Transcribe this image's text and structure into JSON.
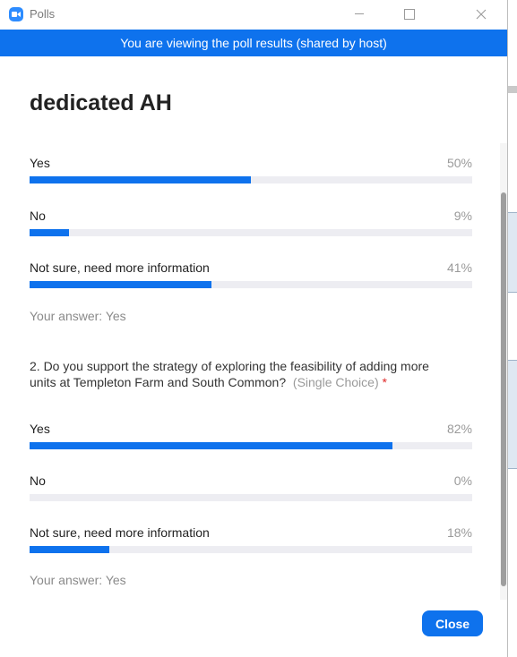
{
  "window": {
    "title": "Polls",
    "icon": "zoom-camera-icon"
  },
  "banner": {
    "text": "You are viewing the poll results (shared by host)"
  },
  "poll": {
    "title": "dedicated AH",
    "questions": [
      {
        "text": "",
        "type": "",
        "required": "",
        "answers": [
          {
            "label": "Yes",
            "percent_text": "50%",
            "percent": 50
          },
          {
            "label": "No",
            "percent_text": "9%",
            "percent": 9
          },
          {
            "label": "Not sure, need more information",
            "percent_text": "41%",
            "percent": 41
          }
        ],
        "your_answer": "Your answer: Yes"
      },
      {
        "text": "2. Do you support the strategy of exploring the feasibility of adding more units at Templeton Farm and South Common?",
        "type": "(Single Choice)",
        "required": "*",
        "answers": [
          {
            "label": "Yes",
            "percent_text": "82%",
            "percent": 82
          },
          {
            "label": "No",
            "percent_text": "0%",
            "percent": 0
          },
          {
            "label": "Not sure, need more information",
            "percent_text": "18%",
            "percent": 18
          }
        ],
        "your_answer": "Your answer: Yes"
      }
    ]
  },
  "footer": {
    "close_label": "Close"
  },
  "colors": {
    "accent": "#0e72ed",
    "bar_track": "#ededf2",
    "muted_text": "#8a8a8a",
    "required": "#e02828"
  }
}
